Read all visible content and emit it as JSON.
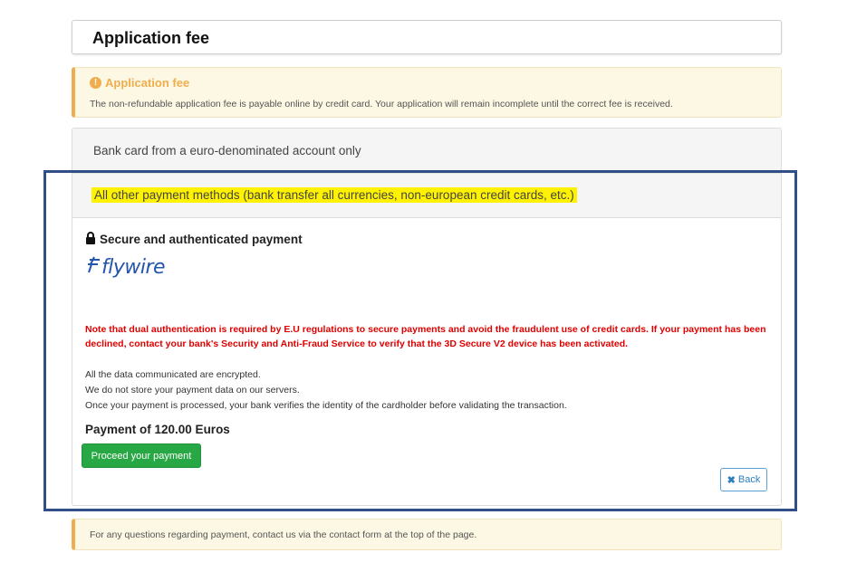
{
  "header": {
    "title": "Application fee"
  },
  "warning": {
    "title": "Application fee",
    "icon": "exclamation-circle-icon",
    "text": "The non-refundable application fee is payable online by credit card. Your application will remain incomplete until the correct fee is received."
  },
  "accordion": {
    "option1": "Bank card from a euro-denominated account only",
    "option2": "All other payment methods (bank transfer all currencies, non-european credit cards, etc.)"
  },
  "panel": {
    "secure_title": "Secure and authenticated payment",
    "logo_text": "flywire",
    "note": "Note that dual authentication is required by E.U regulations to secure payments and avoid the fraudulent use of credit cards. If your payment has been declined, contact your bank's Security and Anti-Fraud Service to verify that the 3D Secure V2 device has been activated.",
    "info": [
      "All the data communicated are encrypted.",
      "We do not store your payment data on our servers.",
      "Once your payment is processed, your bank verifies the identity of the cardholder before validating the transaction."
    ],
    "amount": "Payment of 120.00 Euros",
    "pay_button": "Proceed your payment",
    "back_button": "Back"
  },
  "footer_note": "For any questions regarding payment, contact us via the contact form at the top of the page.",
  "colors": {
    "warning": "#f0ad4e",
    "highlight": "#fff200",
    "note_red": "#e00000",
    "pay_green": "#28a745",
    "frame_blue": "#2f4f86",
    "flywire_blue": "#2456ad"
  }
}
